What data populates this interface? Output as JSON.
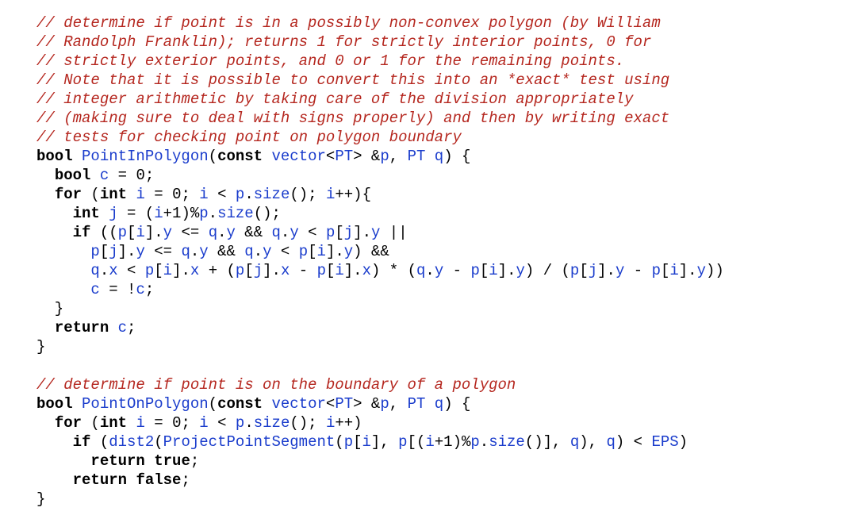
{
  "colors": {
    "comment": "#b5271f",
    "keyword": "#000000",
    "identifier": "#1a3ccc",
    "punctuation": "#000000",
    "background": "#ffffff"
  },
  "code_lines": [
    [
      [
        "c",
        "// determine if point is in a possibly non-convex polygon (by William"
      ]
    ],
    [
      [
        "c",
        "// Randolph Franklin); returns 1 for strictly interior points, 0 for"
      ]
    ],
    [
      [
        "c",
        "// strictly exterior points, and 0 or 1 for the remaining points."
      ]
    ],
    [
      [
        "c",
        "// Note that it is possible to convert this into an *exact* test using"
      ]
    ],
    [
      [
        "c",
        "// integer arithmetic by taking care of the division appropriately"
      ]
    ],
    [
      [
        "c",
        "// (making sure to deal with signs properly) and then by writing exact"
      ]
    ],
    [
      [
        "c",
        "// tests for checking point on polygon boundary"
      ]
    ],
    [
      [
        "k",
        "bool"
      ],
      [
        "p",
        " "
      ],
      [
        "i",
        "PointInPolygon"
      ],
      [
        "p",
        "("
      ],
      [
        "k",
        "const"
      ],
      [
        "p",
        " "
      ],
      [
        "i",
        "vector"
      ],
      [
        "p",
        "<"
      ],
      [
        "i",
        "PT"
      ],
      [
        "p",
        "> &"
      ],
      [
        "i",
        "p"
      ],
      [
        "p",
        ", "
      ],
      [
        "i",
        "PT"
      ],
      [
        "p",
        " "
      ],
      [
        "i",
        "q"
      ],
      [
        "p",
        ") {"
      ]
    ],
    [
      [
        "p",
        "  "
      ],
      [
        "k",
        "bool"
      ],
      [
        "p",
        " "
      ],
      [
        "i",
        "c"
      ],
      [
        "p",
        " = 0;"
      ]
    ],
    [
      [
        "p",
        "  "
      ],
      [
        "k",
        "for"
      ],
      [
        "p",
        " ("
      ],
      [
        "k",
        "int"
      ],
      [
        "p",
        " "
      ],
      [
        "i",
        "i"
      ],
      [
        "p",
        " = 0; "
      ],
      [
        "i",
        "i"
      ],
      [
        "p",
        " < "
      ],
      [
        "i",
        "p"
      ],
      [
        "p",
        "."
      ],
      [
        "i",
        "size"
      ],
      [
        "p",
        "(); "
      ],
      [
        "i",
        "i"
      ],
      [
        "p",
        "++){"
      ]
    ],
    [
      [
        "p",
        "    "
      ],
      [
        "k",
        "int"
      ],
      [
        "p",
        " "
      ],
      [
        "i",
        "j"
      ],
      [
        "p",
        " = ("
      ],
      [
        "i",
        "i"
      ],
      [
        "p",
        "+1)%"
      ],
      [
        "i",
        "p"
      ],
      [
        "p",
        "."
      ],
      [
        "i",
        "size"
      ],
      [
        "p",
        "();"
      ]
    ],
    [
      [
        "p",
        "    "
      ],
      [
        "k",
        "if"
      ],
      [
        "p",
        " (("
      ],
      [
        "i",
        "p"
      ],
      [
        "p",
        "["
      ],
      [
        "i",
        "i"
      ],
      [
        "p",
        "]."
      ],
      [
        "i",
        "y"
      ],
      [
        "p",
        " <= "
      ],
      [
        "i",
        "q"
      ],
      [
        "p",
        "."
      ],
      [
        "i",
        "y"
      ],
      [
        "p",
        " && "
      ],
      [
        "i",
        "q"
      ],
      [
        "p",
        "."
      ],
      [
        "i",
        "y"
      ],
      [
        "p",
        " < "
      ],
      [
        "i",
        "p"
      ],
      [
        "p",
        "["
      ],
      [
        "i",
        "j"
      ],
      [
        "p",
        "]."
      ],
      [
        "i",
        "y"
      ],
      [
        "p",
        " ||"
      ]
    ],
    [
      [
        "p",
        "      "
      ],
      [
        "i",
        "p"
      ],
      [
        "p",
        "["
      ],
      [
        "i",
        "j"
      ],
      [
        "p",
        "]."
      ],
      [
        "i",
        "y"
      ],
      [
        "p",
        " <= "
      ],
      [
        "i",
        "q"
      ],
      [
        "p",
        "."
      ],
      [
        "i",
        "y"
      ],
      [
        "p",
        " && "
      ],
      [
        "i",
        "q"
      ],
      [
        "p",
        "."
      ],
      [
        "i",
        "y"
      ],
      [
        "p",
        " < "
      ],
      [
        "i",
        "p"
      ],
      [
        "p",
        "["
      ],
      [
        "i",
        "i"
      ],
      [
        "p",
        "]."
      ],
      [
        "i",
        "y"
      ],
      [
        "p",
        ") &&"
      ]
    ],
    [
      [
        "p",
        "      "
      ],
      [
        "i",
        "q"
      ],
      [
        "p",
        "."
      ],
      [
        "i",
        "x"
      ],
      [
        "p",
        " < "
      ],
      [
        "i",
        "p"
      ],
      [
        "p",
        "["
      ],
      [
        "i",
        "i"
      ],
      [
        "p",
        "]."
      ],
      [
        "i",
        "x"
      ],
      [
        "p",
        " + ("
      ],
      [
        "i",
        "p"
      ],
      [
        "p",
        "["
      ],
      [
        "i",
        "j"
      ],
      [
        "p",
        "]."
      ],
      [
        "i",
        "x"
      ],
      [
        "p",
        " - "
      ],
      [
        "i",
        "p"
      ],
      [
        "p",
        "["
      ],
      [
        "i",
        "i"
      ],
      [
        "p",
        "]."
      ],
      [
        "i",
        "x"
      ],
      [
        "p",
        ") * ("
      ],
      [
        "i",
        "q"
      ],
      [
        "p",
        "."
      ],
      [
        "i",
        "y"
      ],
      [
        "p",
        " - "
      ],
      [
        "i",
        "p"
      ],
      [
        "p",
        "["
      ],
      [
        "i",
        "i"
      ],
      [
        "p",
        "]."
      ],
      [
        "i",
        "y"
      ],
      [
        "p",
        ") / ("
      ],
      [
        "i",
        "p"
      ],
      [
        "p",
        "["
      ],
      [
        "i",
        "j"
      ],
      [
        "p",
        "]."
      ],
      [
        "i",
        "y"
      ],
      [
        "p",
        " - "
      ],
      [
        "i",
        "p"
      ],
      [
        "p",
        "["
      ],
      [
        "i",
        "i"
      ],
      [
        "p",
        "]."
      ],
      [
        "i",
        "y"
      ],
      [
        "p",
        "))"
      ]
    ],
    [
      [
        "p",
        "      "
      ],
      [
        "i",
        "c"
      ],
      [
        "p",
        " = !"
      ],
      [
        "i",
        "c"
      ],
      [
        "p",
        ";"
      ]
    ],
    [
      [
        "p",
        "  }"
      ]
    ],
    [
      [
        "p",
        "  "
      ],
      [
        "k",
        "return"
      ],
      [
        "p",
        " "
      ],
      [
        "i",
        "c"
      ],
      [
        "p",
        ";"
      ]
    ],
    [
      [
        "p",
        "}"
      ]
    ],
    [],
    [
      [
        "c",
        "// determine if point is on the boundary of a polygon"
      ]
    ],
    [
      [
        "k",
        "bool"
      ],
      [
        "p",
        " "
      ],
      [
        "i",
        "PointOnPolygon"
      ],
      [
        "p",
        "("
      ],
      [
        "k",
        "const"
      ],
      [
        "p",
        " "
      ],
      [
        "i",
        "vector"
      ],
      [
        "p",
        "<"
      ],
      [
        "i",
        "PT"
      ],
      [
        "p",
        "> &"
      ],
      [
        "i",
        "p"
      ],
      [
        "p",
        ", "
      ],
      [
        "i",
        "PT"
      ],
      [
        "p",
        " "
      ],
      [
        "i",
        "q"
      ],
      [
        "p",
        ") {"
      ]
    ],
    [
      [
        "p",
        "  "
      ],
      [
        "k",
        "for"
      ],
      [
        "p",
        " ("
      ],
      [
        "k",
        "int"
      ],
      [
        "p",
        " "
      ],
      [
        "i",
        "i"
      ],
      [
        "p",
        " = 0; "
      ],
      [
        "i",
        "i"
      ],
      [
        "p",
        " < "
      ],
      [
        "i",
        "p"
      ],
      [
        "p",
        "."
      ],
      [
        "i",
        "size"
      ],
      [
        "p",
        "(); "
      ],
      [
        "i",
        "i"
      ],
      [
        "p",
        "++)"
      ]
    ],
    [
      [
        "p",
        "    "
      ],
      [
        "k",
        "if"
      ],
      [
        "p",
        " ("
      ],
      [
        "i",
        "dist2"
      ],
      [
        "p",
        "("
      ],
      [
        "i",
        "ProjectPointSegment"
      ],
      [
        "p",
        "("
      ],
      [
        "i",
        "p"
      ],
      [
        "p",
        "["
      ],
      [
        "i",
        "i"
      ],
      [
        "p",
        "], "
      ],
      [
        "i",
        "p"
      ],
      [
        "p",
        "[("
      ],
      [
        "i",
        "i"
      ],
      [
        "p",
        "+1)%"
      ],
      [
        "i",
        "p"
      ],
      [
        "p",
        "."
      ],
      [
        "i",
        "size"
      ],
      [
        "p",
        "()], "
      ],
      [
        "i",
        "q"
      ],
      [
        "p",
        "), "
      ],
      [
        "i",
        "q"
      ],
      [
        "p",
        ") < "
      ],
      [
        "i",
        "EPS"
      ],
      [
        "p",
        ")"
      ]
    ],
    [
      [
        "p",
        "      "
      ],
      [
        "k",
        "return"
      ],
      [
        "p",
        " "
      ],
      [
        "k",
        "true"
      ],
      [
        "p",
        ";"
      ]
    ],
    [
      [
        "p",
        "    "
      ],
      [
        "k",
        "return"
      ],
      [
        "p",
        " "
      ],
      [
        "k",
        "false"
      ],
      [
        "p",
        ";"
      ]
    ],
    [
      [
        "p",
        "}"
      ]
    ]
  ]
}
